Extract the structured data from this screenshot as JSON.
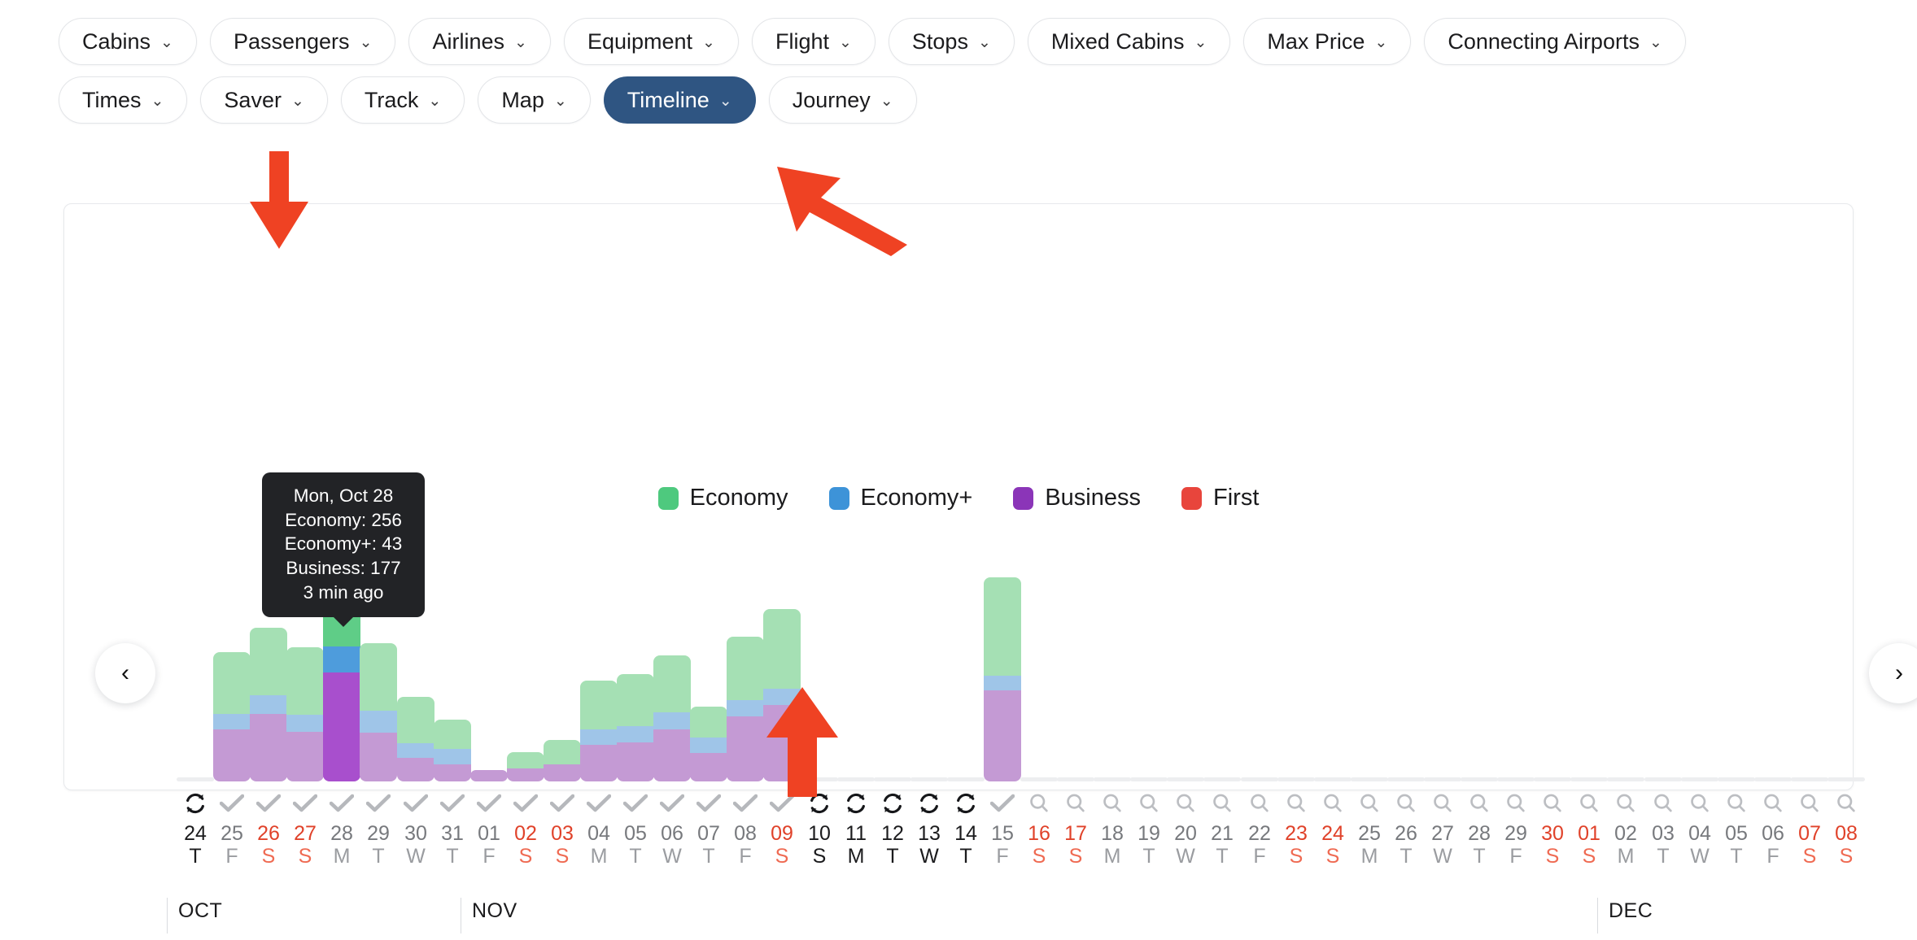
{
  "filters": {
    "row1": [
      {
        "label": "Cabins",
        "active": false
      },
      {
        "label": "Passengers",
        "active": false
      },
      {
        "label": "Airlines",
        "active": false
      },
      {
        "label": "Equipment",
        "active": false
      },
      {
        "label": "Flight",
        "active": false
      },
      {
        "label": "Stops",
        "active": false
      },
      {
        "label": "Mixed Cabins",
        "active": false
      },
      {
        "label": "Max Price",
        "active": false
      },
      {
        "label": "Connecting Airports",
        "active": false
      }
    ],
    "row2": [
      {
        "label": "Times",
        "active": false
      },
      {
        "label": "Saver",
        "active": false
      },
      {
        "label": "Track",
        "active": false
      },
      {
        "label": "Map",
        "active": false
      },
      {
        "label": "Timeline",
        "active": true
      },
      {
        "label": "Journey",
        "active": false
      }
    ],
    "caret": "⌄"
  },
  "nav": {
    "prev": "‹",
    "next": "›"
  },
  "tooltip": {
    "date": "Mon, Oct 28",
    "economy": "Economy: 256",
    "economy_plus": "Economy+: 43",
    "business": "Business: 177",
    "updated": "3 min ago"
  },
  "colors": {
    "economy": "#4ec97e",
    "economy_plus": "#3d93d8",
    "business": "#8b35b8",
    "first": "#e8453c",
    "economy_muted": "#a5e0b4",
    "economy_plus_muted": "#9fc5e8",
    "business_muted": "#c49ad4",
    "economy_hover": "#5fcd87",
    "economy_plus_hover": "#4e9cdc",
    "business_hover": "#a84fcd",
    "accent_active": "#2f5582",
    "weekend": "#e0422a",
    "annotation": "#ef4223"
  },
  "chart_data": {
    "type": "bar",
    "stacked": true,
    "title": "",
    "xlabel": "",
    "ylabel": "",
    "legend": [
      {
        "name": "Economy",
        "color": "#4ec97e"
      },
      {
        "name": "Economy+",
        "color": "#3d93d8"
      },
      {
        "name": "Business",
        "color": "#8b35b8"
      },
      {
        "name": "First",
        "color": "#e8453c"
      }
    ],
    "legend_position": "top-center",
    "grid": false,
    "series_order": [
      "business",
      "economy_plus",
      "economy",
      "first"
    ],
    "months": [
      {
        "label": "OCT",
        "index": 0
      },
      {
        "label": "NOV",
        "index": 8
      },
      {
        "label": "DEC",
        "index": 39
      }
    ],
    "hovered_index": 4,
    "days": [
      {
        "day": "24",
        "dow": "T",
        "weekend": false,
        "strong": true,
        "status": "loading",
        "economy": 0,
        "economy_plus": 0,
        "business": 0,
        "first": 0
      },
      {
        "day": "25",
        "dow": "F",
        "weekend": false,
        "strong": false,
        "status": "done",
        "economy": 100,
        "economy_plus": 25,
        "business": 85,
        "first": 0
      },
      {
        "day": "26",
        "dow": "S",
        "weekend": true,
        "strong": false,
        "status": "done",
        "economy": 110,
        "economy_plus": 30,
        "business": 110,
        "first": 0
      },
      {
        "day": "27",
        "dow": "S",
        "weekend": true,
        "strong": false,
        "status": "done",
        "economy": 110,
        "economy_plus": 28,
        "business": 80,
        "first": 0
      },
      {
        "day": "28",
        "dow": "M",
        "weekend": false,
        "strong": false,
        "status": "done",
        "economy": 256,
        "economy_plus": 43,
        "business": 177,
        "first": 0
      },
      {
        "day": "29",
        "dow": "T",
        "weekend": false,
        "strong": false,
        "status": "done",
        "economy": 110,
        "economy_plus": 35,
        "business": 80,
        "first": 0
      },
      {
        "day": "30",
        "dow": "W",
        "weekend": false,
        "strong": false,
        "status": "done",
        "economy": 75,
        "economy_plus": 25,
        "business": 38,
        "first": 0
      },
      {
        "day": "31",
        "dow": "T",
        "weekend": false,
        "strong": false,
        "status": "done",
        "economy": 48,
        "economy_plus": 25,
        "business": 27,
        "first": 0
      },
      {
        "day": "01",
        "dow": "F",
        "weekend": false,
        "strong": false,
        "status": "done",
        "economy": 0,
        "economy_plus": 0,
        "business": 18,
        "first": 0
      },
      {
        "day": "02",
        "dow": "S",
        "weekend": true,
        "strong": false,
        "status": "done",
        "economy": 26,
        "economy_plus": 0,
        "business": 22,
        "first": 0
      },
      {
        "day": "03",
        "dow": "S",
        "weekend": true,
        "strong": false,
        "status": "done",
        "economy": 40,
        "economy_plus": 0,
        "business": 27,
        "first": 0
      },
      {
        "day": "04",
        "dow": "M",
        "weekend": false,
        "strong": false,
        "status": "done",
        "economy": 80,
        "economy_plus": 24,
        "business": 60,
        "first": 0
      },
      {
        "day": "05",
        "dow": "T",
        "weekend": false,
        "strong": false,
        "status": "done",
        "economy": 85,
        "economy_plus": 26,
        "business": 63,
        "first": 0
      },
      {
        "day": "06",
        "dow": "W",
        "weekend": false,
        "strong": false,
        "status": "done",
        "economy": 92,
        "economy_plus": 28,
        "business": 85,
        "first": 0
      },
      {
        "day": "07",
        "dow": "T",
        "weekend": false,
        "strong": false,
        "status": "done",
        "economy": 50,
        "economy_plus": 26,
        "business": 46,
        "first": 0
      },
      {
        "day": "08",
        "dow": "F",
        "weekend": false,
        "strong": false,
        "status": "done",
        "economy": 103,
        "economy_plus": 27,
        "business": 105,
        "first": 0
      },
      {
        "day": "09",
        "dow": "S",
        "weekend": true,
        "strong": false,
        "status": "done",
        "economy": 130,
        "economy_plus": 26,
        "business": 124,
        "first": 0
      },
      {
        "day": "10",
        "dow": "S",
        "weekend": true,
        "strong": true,
        "status": "loading",
        "economy": 0,
        "economy_plus": 0,
        "business": 0,
        "first": 0
      },
      {
        "day": "11",
        "dow": "M",
        "weekend": false,
        "strong": true,
        "status": "loading",
        "economy": 0,
        "economy_plus": 0,
        "business": 0,
        "first": 0
      },
      {
        "day": "12",
        "dow": "T",
        "weekend": false,
        "strong": true,
        "status": "loading",
        "economy": 0,
        "economy_plus": 0,
        "business": 0,
        "first": 0
      },
      {
        "day": "13",
        "dow": "W",
        "weekend": false,
        "strong": true,
        "status": "loading",
        "economy": 0,
        "economy_plus": 0,
        "business": 0,
        "first": 0
      },
      {
        "day": "14",
        "dow": "T",
        "weekend": false,
        "strong": true,
        "status": "loading",
        "economy": 0,
        "economy_plus": 0,
        "business": 0,
        "first": 0
      },
      {
        "day": "15",
        "dow": "F",
        "weekend": false,
        "strong": false,
        "status": "done",
        "economy": 160,
        "economy_plus": 24,
        "business": 148,
        "first": 0
      },
      {
        "day": "16",
        "dow": "S",
        "weekend": true,
        "strong": false,
        "status": "search",
        "economy": 0,
        "economy_plus": 0,
        "business": 0,
        "first": 0
      },
      {
        "day": "17",
        "dow": "S",
        "weekend": true,
        "strong": false,
        "status": "search",
        "economy": 0,
        "economy_plus": 0,
        "business": 0,
        "first": 0
      },
      {
        "day": "18",
        "dow": "M",
        "weekend": false,
        "strong": false,
        "status": "search",
        "economy": 0,
        "economy_plus": 0,
        "business": 0,
        "first": 0
      },
      {
        "day": "19",
        "dow": "T",
        "weekend": false,
        "strong": false,
        "status": "search",
        "economy": 0,
        "economy_plus": 0,
        "business": 0,
        "first": 0
      },
      {
        "day": "20",
        "dow": "W",
        "weekend": false,
        "strong": false,
        "status": "search",
        "economy": 0,
        "economy_plus": 0,
        "business": 0,
        "first": 0
      },
      {
        "day": "21",
        "dow": "T",
        "weekend": false,
        "strong": false,
        "status": "search",
        "economy": 0,
        "economy_plus": 0,
        "business": 0,
        "first": 0
      },
      {
        "day": "22",
        "dow": "F",
        "weekend": false,
        "strong": false,
        "status": "search",
        "economy": 0,
        "economy_plus": 0,
        "business": 0,
        "first": 0
      },
      {
        "day": "23",
        "dow": "S",
        "weekend": true,
        "strong": false,
        "status": "search",
        "economy": 0,
        "economy_plus": 0,
        "business": 0,
        "first": 0
      },
      {
        "day": "24",
        "dow": "S",
        "weekend": true,
        "strong": false,
        "status": "search",
        "economy": 0,
        "economy_plus": 0,
        "business": 0,
        "first": 0
      },
      {
        "day": "25",
        "dow": "M",
        "weekend": false,
        "strong": false,
        "status": "search",
        "economy": 0,
        "economy_plus": 0,
        "business": 0,
        "first": 0
      },
      {
        "day": "26",
        "dow": "T",
        "weekend": false,
        "strong": false,
        "status": "search",
        "economy": 0,
        "economy_plus": 0,
        "business": 0,
        "first": 0
      },
      {
        "day": "27",
        "dow": "W",
        "weekend": false,
        "strong": false,
        "status": "search",
        "economy": 0,
        "economy_plus": 0,
        "business": 0,
        "first": 0
      },
      {
        "day": "28",
        "dow": "T",
        "weekend": false,
        "strong": false,
        "status": "search",
        "economy": 0,
        "economy_plus": 0,
        "business": 0,
        "first": 0
      },
      {
        "day": "29",
        "dow": "F",
        "weekend": false,
        "strong": false,
        "status": "search",
        "economy": 0,
        "economy_plus": 0,
        "business": 0,
        "first": 0
      },
      {
        "day": "30",
        "dow": "S",
        "weekend": true,
        "strong": false,
        "status": "search",
        "economy": 0,
        "economy_plus": 0,
        "business": 0,
        "first": 0
      },
      {
        "day": "01",
        "dow": "S",
        "weekend": true,
        "strong": false,
        "status": "search",
        "economy": 0,
        "economy_plus": 0,
        "business": 0,
        "first": 0
      },
      {
        "day": "02",
        "dow": "M",
        "weekend": false,
        "strong": false,
        "status": "search",
        "economy": 0,
        "economy_plus": 0,
        "business": 0,
        "first": 0
      },
      {
        "day": "03",
        "dow": "T",
        "weekend": false,
        "strong": false,
        "status": "search",
        "economy": 0,
        "economy_plus": 0,
        "business": 0,
        "first": 0
      },
      {
        "day": "04",
        "dow": "W",
        "weekend": false,
        "strong": false,
        "status": "search",
        "economy": 0,
        "economy_plus": 0,
        "business": 0,
        "first": 0
      },
      {
        "day": "05",
        "dow": "T",
        "weekend": false,
        "strong": false,
        "status": "search",
        "economy": 0,
        "economy_plus": 0,
        "business": 0,
        "first": 0
      },
      {
        "day": "06",
        "dow": "F",
        "weekend": false,
        "strong": false,
        "status": "search",
        "economy": 0,
        "economy_plus": 0,
        "business": 0,
        "first": 0
      },
      {
        "day": "07",
        "dow": "S",
        "weekend": true,
        "strong": false,
        "status": "search",
        "economy": 0,
        "economy_plus": 0,
        "business": 0,
        "first": 0
      },
      {
        "day": "08",
        "dow": "S",
        "weekend": true,
        "strong": false,
        "status": "search",
        "economy": 0,
        "economy_plus": 0,
        "business": 0,
        "first": 0
      }
    ]
  },
  "annotations": [
    {
      "name": "saver-arrow",
      "direction": "down"
    },
    {
      "name": "timeline-arrow",
      "direction": "up-left"
    },
    {
      "name": "date-arrow",
      "direction": "up"
    }
  ]
}
